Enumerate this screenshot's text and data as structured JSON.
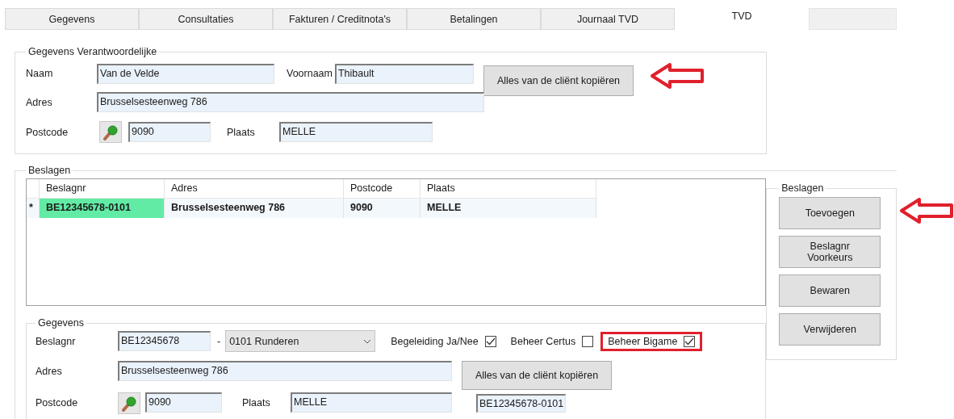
{
  "tabs": [
    {
      "label": "Gegevens",
      "selected": false
    },
    {
      "label": "Consultaties",
      "selected": false
    },
    {
      "label": "Fakturen / Creditnota's",
      "selected": false
    },
    {
      "label": "Betalingen",
      "selected": false
    },
    {
      "label": "Journaal TVD",
      "selected": false
    },
    {
      "label": "TVD",
      "selected": true
    }
  ],
  "responsible": {
    "legend": "Gegevens Verantwoordelijke",
    "name_label": "Naam",
    "name": "Van de Velde",
    "first_name_label": "Voornaam",
    "first_name": "Thibault",
    "copy_button": "Alles van de cliënt kopiëren",
    "address_label": "Adres",
    "address": "Brusselsesteenweg 786",
    "postcode_label": "Postcode",
    "postcode": "9090",
    "city_label": "Plaats",
    "city": "MELLE"
  },
  "seizures": {
    "legend": "Beslagen",
    "table": {
      "columns": [
        "Beslagnr",
        "Adres",
        "Postcode",
        "Plaats"
      ],
      "rows": [
        {
          "marker": "*",
          "selected": true,
          "cells": [
            "BE12345678-0101",
            "Brusselsesteenweg 786",
            "9090",
            "MELLE"
          ]
        }
      ]
    },
    "details": {
      "legend": "Gegevens",
      "number_label": "Beslagnr",
      "number": "BE12345678",
      "separator": "-",
      "species": "0101  Runderen",
      "checks": [
        {
          "label": "Begeleiding Ja/Nee",
          "checked": true,
          "highlighted": false
        },
        {
          "label": "Beheer Certus",
          "checked": false,
          "highlighted": false
        },
        {
          "label": "Beheer Bigame",
          "checked": true,
          "highlighted": true
        }
      ],
      "address_label": "Adres",
      "address": "Brusselsesteenweg 786",
      "copy_button": "Alles van de cliënt kopiëren",
      "postcode_label": "Postcode",
      "postcode": "9090",
      "city_label": "Plaats",
      "city": "MELLE",
      "full_number": "BE12345678-0101"
    }
  },
  "actions": {
    "legend": "Beslagen",
    "buttons": [
      "Toevoegen",
      "Beslagnr Voorkeurs",
      "Bewaren",
      "Verwijderen"
    ]
  }
}
